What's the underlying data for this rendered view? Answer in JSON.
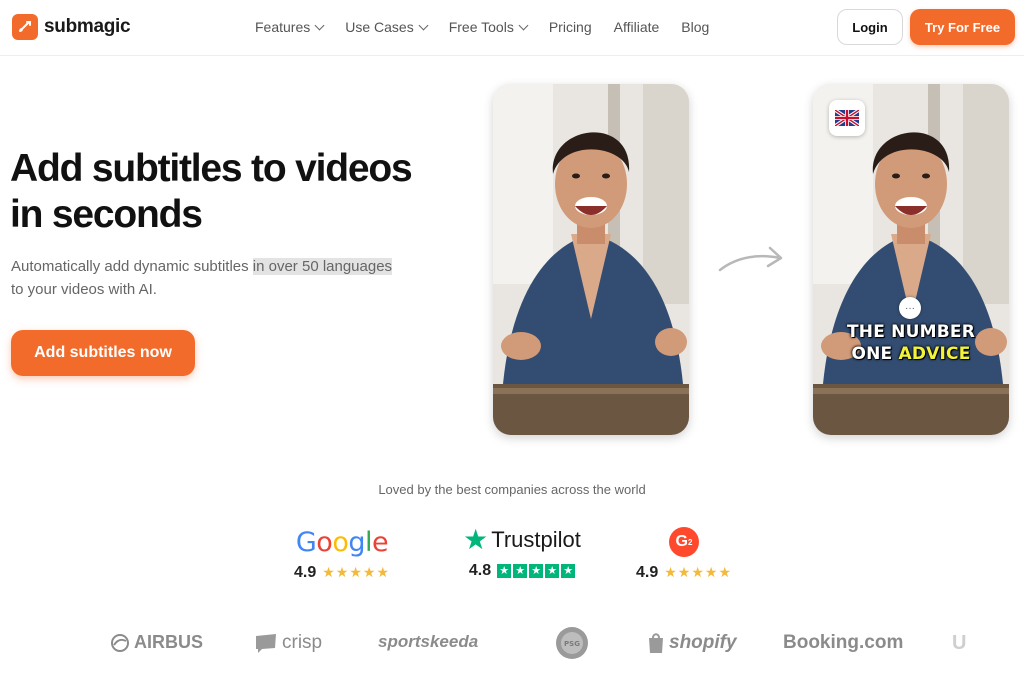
{
  "nav": {
    "logo_text": "submagic",
    "menu": [
      {
        "label": "Features",
        "dropdown": true
      },
      {
        "label": "Use Cases",
        "dropdown": true
      },
      {
        "label": "Free Tools",
        "dropdown": true
      },
      {
        "label": "Pricing",
        "dropdown": false
      },
      {
        "label": "Affiliate",
        "dropdown": false
      },
      {
        "label": "Blog",
        "dropdown": false
      }
    ],
    "login_label": "Login",
    "try_label": "Try For Free"
  },
  "hero": {
    "title_line1": "Add subtitles to videos",
    "title_line2": "in seconds",
    "subtitle_pre": "Automatically add dynamic subtitles ",
    "subtitle_highlight": "in over 50 languages",
    "subtitle_post": "to your videos with AI.",
    "cta_label": "Add subtitles now"
  },
  "preview": {
    "caption_line1": "THE NUMBER",
    "caption_word1": "ONE",
    "caption_keyword": "ADVICE",
    "flag_icon": "uk-flag-icon",
    "bubble_text": "···"
  },
  "social_proof": {
    "heading": "Loved by the best companies across the world",
    "ratings": [
      {
        "platform": "Google",
        "score": "4.9",
        "stars": "★★★★★"
      },
      {
        "platform": "Trustpilot",
        "score": "4.8",
        "stars": "★★★★★"
      },
      {
        "platform": "G2",
        "score": "4.9",
        "stars": "★★★★★"
      }
    ],
    "brands": [
      "AIRBUS",
      "crisp",
      "sportskeeda",
      "PSG",
      "shopify",
      "Booking.com",
      "U"
    ]
  },
  "colors": {
    "accent": "#f26b2b",
    "trustpilot": "#00b67a",
    "stars": "#f3b93a",
    "caption_keyword": "#f3f33a"
  }
}
